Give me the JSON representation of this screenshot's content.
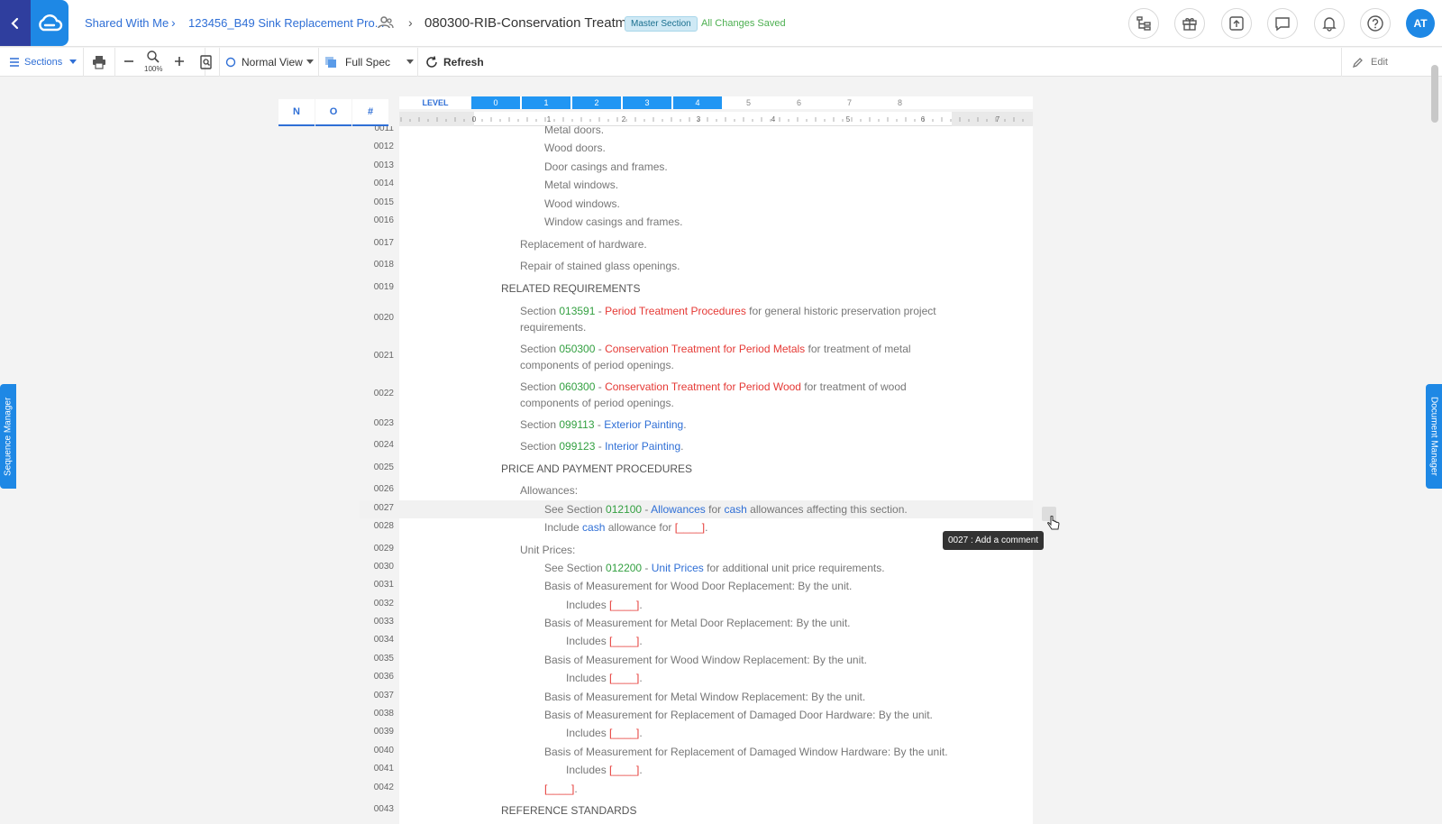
{
  "header": {
    "breadcrumbs": [
      "Shared With Me",
      "123456_B49 Sink Replacement Pro..."
    ],
    "title": "080300-RIB-Conservation Treatm...",
    "badge": "Master Section",
    "save_status": "All Changes Saved",
    "avatar": "AT"
  },
  "toolbar": {
    "sections": "Sections",
    "zoom": "100%",
    "view": "Normal View",
    "spec": "Full Spec",
    "refresh": "Refresh",
    "edit": "Edit"
  },
  "columns": [
    "N",
    "O",
    "#"
  ],
  "levels": {
    "label": "LEVEL",
    "items": [
      "0",
      "1",
      "2",
      "3",
      "4",
      "5",
      "6",
      "7",
      "8"
    ],
    "active_count": 5
  },
  "ruler": [
    "0",
    "1",
    "2",
    "3",
    "4",
    "5",
    "6",
    "7"
  ],
  "lines": [
    {
      "no": "0011",
      "parts": [
        {
          "t": "Metal doors."
        }
      ]
    },
    {
      "no": "0012",
      "parts": [
        {
          "t": "Wood doors."
        }
      ]
    },
    {
      "no": "0013",
      "parts": [
        {
          "t": "Door casings and frames."
        }
      ]
    },
    {
      "no": "0014",
      "parts": [
        {
          "t": "Metal windows."
        }
      ]
    },
    {
      "no": "0015",
      "parts": [
        {
          "t": "Wood windows."
        }
      ]
    },
    {
      "no": "0016",
      "parts": [
        {
          "t": "Window casings and frames."
        }
      ]
    },
    {
      "no": "0017",
      "parts": [
        {
          "t": "Replacement of hardware."
        }
      ]
    },
    {
      "no": "0018",
      "parts": [
        {
          "t": "Repair of stained glass openings."
        }
      ]
    },
    {
      "no": "0019",
      "parts": [
        {
          "t": "RELATED REQUIREMENTS"
        }
      ]
    },
    {
      "no": "0020",
      "parts": [
        {
          "t": "Section "
        },
        {
          "t": "013591",
          "c": "sec"
        },
        {
          "t": " - "
        },
        {
          "t": "Period Treatment Procedures",
          "c": "red"
        },
        {
          "t": " for general historic preservation project requirements."
        }
      ]
    },
    {
      "no": "0021",
      "parts": [
        {
          "t": "Section "
        },
        {
          "t": "050300",
          "c": "sec"
        },
        {
          "t": " - "
        },
        {
          "t": "Conservation Treatment for Period Metals",
          "c": "red"
        },
        {
          "t": " for treatment of metal components of period openings."
        }
      ]
    },
    {
      "no": "0022",
      "parts": [
        {
          "t": "Section "
        },
        {
          "t": "060300",
          "c": "sec"
        },
        {
          "t": " - "
        },
        {
          "t": "Conservation Treatment for Period Wood",
          "c": "red"
        },
        {
          "t": " for treatment of wood components of period openings."
        }
      ]
    },
    {
      "no": "0023",
      "parts": [
        {
          "t": "Section "
        },
        {
          "t": "099113",
          "c": "sec"
        },
        {
          "t": " - "
        },
        {
          "t": "Exterior Painting",
          "c": "blue"
        },
        {
          "t": "."
        }
      ]
    },
    {
      "no": "0024",
      "parts": [
        {
          "t": "Section "
        },
        {
          "t": "099123",
          "c": "sec"
        },
        {
          "t": " - "
        },
        {
          "t": "Interior Painting",
          "c": "blue"
        },
        {
          "t": "."
        }
      ]
    },
    {
      "no": "0025",
      "parts": [
        {
          "t": "PRICE AND PAYMENT PROCEDURES"
        }
      ]
    },
    {
      "no": "0026",
      "parts": [
        {
          "t": "Allowances:"
        }
      ]
    },
    {
      "no": "0027",
      "parts": [
        {
          "t": "See Section "
        },
        {
          "t": "012100",
          "c": "sec"
        },
        {
          "t": " - "
        },
        {
          "t": "Allowances",
          "c": "blue"
        },
        {
          "t": " for "
        },
        {
          "t": "cash",
          "c": "blue"
        },
        {
          "t": " allowances affecting this section."
        }
      ]
    },
    {
      "no": "0028",
      "parts": [
        {
          "t": "Include "
        },
        {
          "t": "cash",
          "c": "blue"
        },
        {
          "t": " allowance for "
        },
        {
          "t": "[____]",
          "c": "red"
        },
        {
          "t": "."
        }
      ]
    },
    {
      "no": "0029",
      "parts": [
        {
          "t": "Unit Prices:"
        }
      ]
    },
    {
      "no": "0030",
      "parts": [
        {
          "t": "See Section "
        },
        {
          "t": "012200",
          "c": "sec"
        },
        {
          "t": " - "
        },
        {
          "t": "Unit Prices",
          "c": "blue"
        },
        {
          "t": " for additional unit price requirements."
        }
      ]
    },
    {
      "no": "0031",
      "parts": [
        {
          "t": "Basis of Measurement for Wood Door Replacement:  By the unit."
        }
      ]
    },
    {
      "no": "0032",
      "parts": [
        {
          "t": "Includes "
        },
        {
          "t": "[____]",
          "c": "red"
        },
        {
          "t": "."
        }
      ]
    },
    {
      "no": "0033",
      "parts": [
        {
          "t": "Basis of Measurement for Metal Door Replacement:  By the unit."
        }
      ]
    },
    {
      "no": "0034",
      "parts": [
        {
          "t": "Includes "
        },
        {
          "t": "[____]",
          "c": "red"
        },
        {
          "t": "."
        }
      ]
    },
    {
      "no": "0035",
      "parts": [
        {
          "t": "Basis of Measurement for Wood Window Replacement:  By the unit."
        }
      ]
    },
    {
      "no": "0036",
      "parts": [
        {
          "t": "Includes "
        },
        {
          "t": "[____]",
          "c": "red"
        },
        {
          "t": "."
        }
      ]
    },
    {
      "no": "0037",
      "parts": [
        {
          "t": "Basis of Measurement for Metal Window Replacement:  By the unit."
        }
      ]
    },
    {
      "no": "0038",
      "parts": [
        {
          "t": "Basis of Measurement for Replacement of Damaged Door Hardware:  By the unit."
        }
      ]
    },
    {
      "no": "0039",
      "parts": [
        {
          "t": "Includes "
        },
        {
          "t": "[____]",
          "c": "red"
        },
        {
          "t": "."
        }
      ]
    },
    {
      "no": "0040",
      "parts": [
        {
          "t": "Basis of Measurement for Replacement of Damaged Window Hardware:  By the unit."
        }
      ]
    },
    {
      "no": "0041",
      "parts": [
        {
          "t": "Includes "
        },
        {
          "t": "[____]",
          "c": "red"
        },
        {
          "t": "."
        }
      ]
    },
    {
      "no": "0042",
      "parts": [
        {
          "t": "[____]",
          "c": "red"
        },
        {
          "t": "."
        }
      ]
    },
    {
      "no": "0043",
      "parts": [
        {
          "t": "REFERENCE STANDARDS"
        }
      ]
    }
  ],
  "tooltip": "0027 : Add a comment",
  "side_tabs": {
    "left": "Sequence Manager",
    "right": "Document Manager"
  }
}
